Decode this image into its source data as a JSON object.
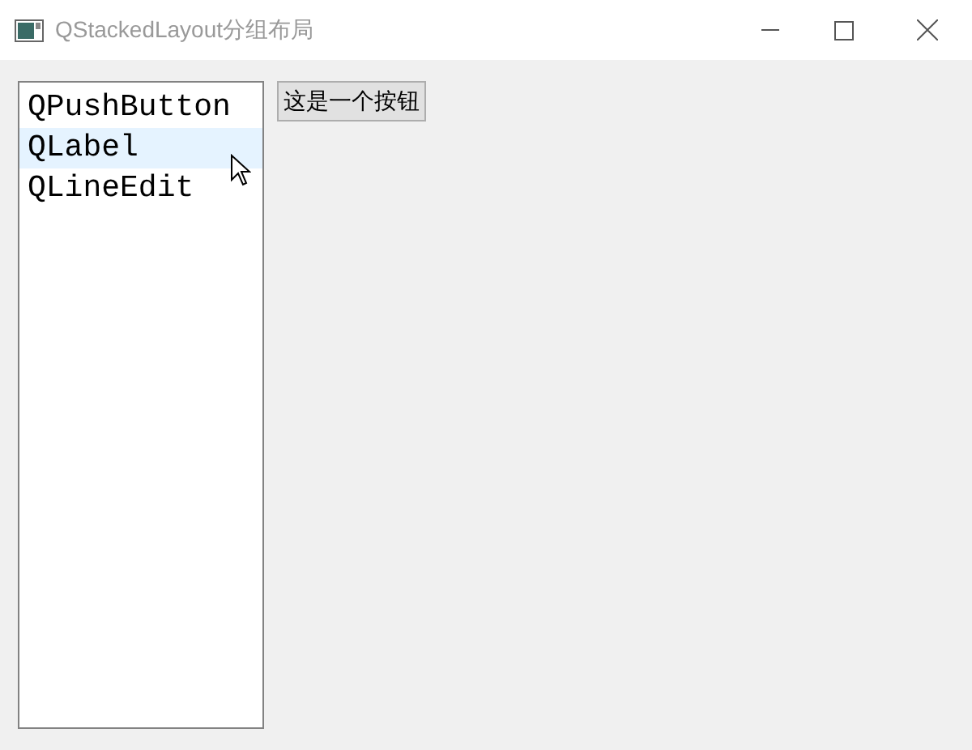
{
  "window": {
    "title": "QStackedLayout分组布局"
  },
  "list": {
    "items": [
      {
        "label": "QPushButton",
        "hovered": false
      },
      {
        "label": "QLabel",
        "hovered": true
      },
      {
        "label": "QLineEdit",
        "hovered": false
      }
    ]
  },
  "button": {
    "label": "这是一个按钮"
  }
}
